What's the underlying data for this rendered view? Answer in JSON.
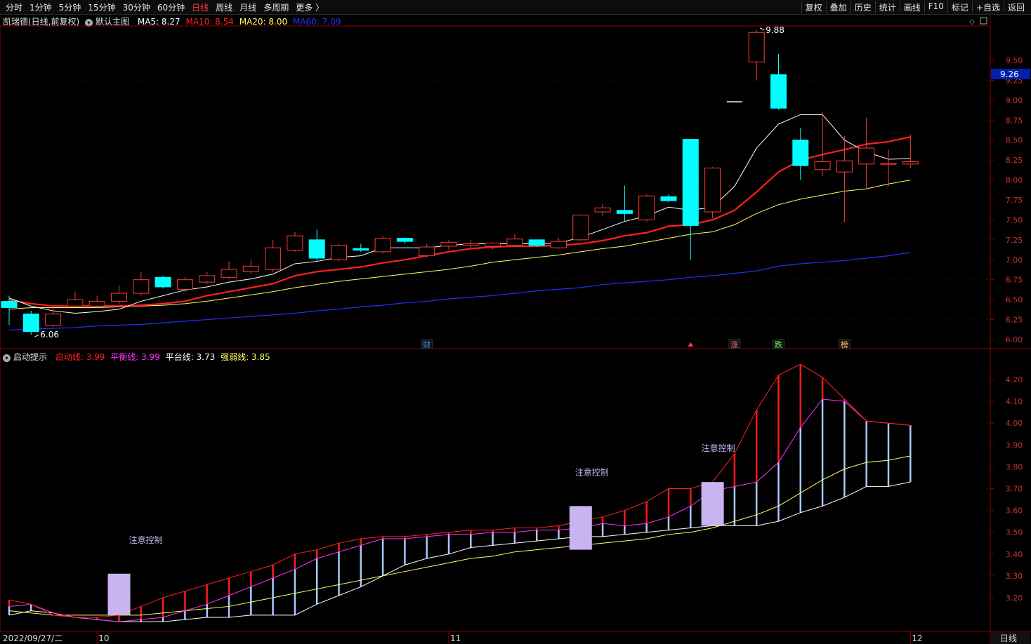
{
  "toolbar": {
    "periods": [
      "分时",
      "1分钟",
      "5分钟",
      "15分钟",
      "30分钟",
      "60分钟",
      "日线",
      "周线",
      "月线",
      "多周期",
      "更多 〉"
    ],
    "active_period": "日线",
    "actions": [
      "复权",
      "叠加",
      "历史",
      "统计",
      "画线",
      "F10",
      "标记",
      "+自选",
      "返回"
    ]
  },
  "main_header": {
    "stock": "凯瑞德(日线,前复权)",
    "template": "默认主图",
    "ma5_label": "MA5: 8.27",
    "ma10_label": "MA10: 8.54",
    "ma20_label": "MA20: 8.00",
    "ma60_label": "MA60: 7.09"
  },
  "sub_header": {
    "name": "启动提示",
    "qidong_label": "启动线: 3.99",
    "pingheng_label": "平衡线: 3.99",
    "pingtai_label": "平台线: 3.73",
    "qiangruo_label": "强弱线: 3.85"
  },
  "annotations": {
    "high": "9.88",
    "low": "6.06",
    "current_price": "9.26",
    "attention": "注意控制",
    "events": [
      "财",
      "涨",
      "跌",
      "榜"
    ]
  },
  "x_axis": {
    "start": "2022/09/27/二",
    "oct": "10",
    "nov": "11",
    "dec": "12",
    "period_label": "日线"
  },
  "colors": {
    "up": "#ff3b3b",
    "down": "#00ffff",
    "ma5": "#ffffff",
    "ma10": "#ff2020",
    "ma20": "#ffff66",
    "ma60": "#2233ff",
    "qidong": "#ff2020",
    "pingheng": "#ff33ff",
    "pingtai": "#ffffff",
    "qiangruo": "#ffff66",
    "attention": "#c8b4f0"
  },
  "chart_data": [
    {
      "type": "candlestick",
      "title": "凯瑞德(日线,前复权)",
      "ylim": [
        6.0,
        9.9
      ],
      "yticks": [
        6.0,
        6.25,
        6.5,
        6.75,
        7.0,
        7.25,
        7.5,
        7.75,
        8.0,
        8.25,
        8.5,
        8.75,
        9.0,
        9.25,
        9.5
      ],
      "candles": [
        {
          "o": 6.48,
          "h": 6.55,
          "l": 6.18,
          "c": 6.4
        },
        {
          "o": 6.32,
          "h": 6.36,
          "l": 6.06,
          "c": 6.1
        },
        {
          "o": 6.18,
          "h": 6.4,
          "l": 6.16,
          "c": 6.32
        },
        {
          "o": 6.42,
          "h": 6.6,
          "l": 6.4,
          "c": 6.5
        },
        {
          "o": 6.42,
          "h": 6.55,
          "l": 6.4,
          "c": 6.48
        },
        {
          "o": 6.48,
          "h": 6.68,
          "l": 6.45,
          "c": 6.58
        },
        {
          "o": 6.58,
          "h": 6.85,
          "l": 6.55,
          "c": 6.75
        },
        {
          "o": 6.78,
          "h": 6.8,
          "l": 6.64,
          "c": 6.66
        },
        {
          "o": 6.63,
          "h": 6.78,
          "l": 6.6,
          "c": 6.75
        },
        {
          "o": 6.72,
          "h": 6.85,
          "l": 6.7,
          "c": 6.8
        },
        {
          "o": 6.78,
          "h": 6.98,
          "l": 6.76,
          "c": 6.88
        },
        {
          "o": 6.85,
          "h": 7.0,
          "l": 6.82,
          "c": 6.92
        },
        {
          "o": 6.88,
          "h": 7.25,
          "l": 6.85,
          "c": 7.15
        },
        {
          "o": 7.12,
          "h": 7.35,
          "l": 7.1,
          "c": 7.3
        },
        {
          "o": 7.25,
          "h": 7.38,
          "l": 6.98,
          "c": 7.02
        },
        {
          "o": 7.0,
          "h": 7.2,
          "l": 6.98,
          "c": 7.18
        },
        {
          "o": 7.14,
          "h": 7.2,
          "l": 7.1,
          "c": 7.12
        },
        {
          "o": 7.1,
          "h": 7.3,
          "l": 7.08,
          "c": 7.27
        },
        {
          "o": 7.27,
          "h": 7.28,
          "l": 7.2,
          "c": 7.23
        },
        {
          "o": 7.05,
          "h": 7.2,
          "l": 7.03,
          "c": 7.16
        },
        {
          "o": 7.17,
          "h": 7.25,
          "l": 7.13,
          "c": 7.22
        },
        {
          "o": 7.18,
          "h": 7.25,
          "l": 7.15,
          "c": 7.2
        },
        {
          "o": 7.17,
          "h": 7.22,
          "l": 7.13,
          "c": 7.21
        },
        {
          "o": 7.18,
          "h": 7.32,
          "l": 7.16,
          "c": 7.26
        },
        {
          "o": 7.25,
          "h": 7.25,
          "l": 7.16,
          "c": 7.18
        },
        {
          "o": 7.15,
          "h": 7.27,
          "l": 7.14,
          "c": 7.23
        },
        {
          "o": 7.25,
          "h": 7.57,
          "l": 7.24,
          "c": 7.56
        },
        {
          "o": 7.6,
          "h": 7.7,
          "l": 7.55,
          "c": 7.65
        },
        {
          "o": 7.62,
          "h": 7.93,
          "l": 7.48,
          "c": 7.58
        },
        {
          "o": 7.5,
          "h": 7.82,
          "l": 7.48,
          "c": 7.8
        },
        {
          "o": 7.79,
          "h": 7.82,
          "l": 7.72,
          "c": 7.74
        },
        {
          "o": 8.51,
          "h": 8.51,
          "l": 7.0,
          "c": 7.43
        },
        {
          "o": 7.6,
          "h": 8.16,
          "l": 7.52,
          "c": 8.15
        },
        {
          "o": 8.98,
          "h": 8.99,
          "l": 8.97,
          "c": 8.98
        },
        {
          "o": 9.48,
          "h": 9.88,
          "l": 9.25,
          "c": 9.85
        },
        {
          "o": 9.32,
          "h": 9.58,
          "l": 8.88,
          "c": 8.9
        },
        {
          "o": 8.5,
          "h": 8.65,
          "l": 8.0,
          "c": 8.18
        },
        {
          "o": 8.13,
          "h": 8.85,
          "l": 8.05,
          "c": 8.23
        },
        {
          "o": 8.1,
          "h": 8.55,
          "l": 7.47,
          "c": 8.24
        },
        {
          "o": 8.2,
          "h": 8.78,
          "l": 7.9,
          "c": 8.4
        },
        {
          "o": 8.2,
          "h": 8.38,
          "l": 7.92,
          "c": 8.21
        },
        {
          "o": 8.2,
          "h": 8.57,
          "l": 8.15,
          "c": 8.23
        }
      ],
      "ma5": [
        6.52,
        6.42,
        6.36,
        6.33,
        6.35,
        6.38,
        6.48,
        6.55,
        6.62,
        6.66,
        6.72,
        6.76,
        6.82,
        6.95,
        6.98,
        7.03,
        7.05,
        7.15,
        7.15,
        7.15,
        7.18,
        7.2,
        7.2,
        7.2,
        7.2,
        7.21,
        7.28,
        7.38,
        7.48,
        7.55,
        7.66,
        7.62,
        7.66,
        7.92,
        8.4,
        8.7,
        8.82,
        8.82,
        8.5,
        8.35,
        8.26,
        8.27
      ],
      "ma10": [
        6.5,
        6.45,
        6.42,
        6.42,
        6.42,
        6.42,
        6.43,
        6.45,
        6.48,
        6.55,
        6.6,
        6.65,
        6.7,
        6.8,
        6.85,
        6.88,
        6.91,
        6.96,
        7.0,
        7.05,
        7.1,
        7.14,
        7.16,
        7.17,
        7.17,
        7.18,
        7.2,
        7.24,
        7.3,
        7.34,
        7.42,
        7.44,
        7.5,
        7.62,
        7.85,
        8.1,
        8.25,
        8.32,
        8.38,
        8.45,
        8.48,
        8.54
      ],
      "ma20": [
        6.38,
        6.4,
        6.4,
        6.4,
        6.4,
        6.41,
        6.42,
        6.43,
        6.45,
        6.48,
        6.52,
        6.56,
        6.6,
        6.65,
        6.69,
        6.73,
        6.76,
        6.79,
        6.82,
        6.85,
        6.88,
        6.92,
        6.97,
        7.0,
        7.03,
        7.06,
        7.1,
        7.14,
        7.17,
        7.22,
        7.27,
        7.32,
        7.35,
        7.44,
        7.58,
        7.69,
        7.76,
        7.81,
        7.86,
        7.89,
        7.95,
        8.0
      ],
      "ma60": [
        6.12,
        6.13,
        6.14,
        6.15,
        6.17,
        6.18,
        6.19,
        6.21,
        6.23,
        6.25,
        6.27,
        6.29,
        6.31,
        6.33,
        6.36,
        6.38,
        6.41,
        6.43,
        6.46,
        6.48,
        6.51,
        6.53,
        6.55,
        6.58,
        6.61,
        6.63,
        6.65,
        6.69,
        6.71,
        6.73,
        6.75,
        6.78,
        6.8,
        6.83,
        6.86,
        6.92,
        6.95,
        6.97,
        6.99,
        7.02,
        7.05,
        7.09
      ]
    },
    {
      "type": "line",
      "title": "启动提示",
      "ylim": [
        3.1,
        4.3
      ],
      "yticks": [
        3.2,
        3.3,
        3.4,
        3.5,
        3.6,
        3.7,
        3.8,
        3.9,
        4.0,
        4.1,
        4.2
      ],
      "series": [
        {
          "name": "启动线",
          "values": [
            3.19,
            3.17,
            3.12,
            3.11,
            3.11,
            3.12,
            3.16,
            3.2,
            3.23,
            3.26,
            3.29,
            3.32,
            3.35,
            3.4,
            3.42,
            3.45,
            3.47,
            3.48,
            3.48,
            3.49,
            3.5,
            3.51,
            3.51,
            3.52,
            3.52,
            3.53,
            3.55,
            3.57,
            3.6,
            3.64,
            3.7,
            3.7,
            3.73,
            3.86,
            4.06,
            4.22,
            4.27,
            4.21,
            4.11,
            4.01,
            4.0,
            3.99
          ]
        },
        {
          "name": "平衡线",
          "values": [
            3.16,
            3.17,
            3.13,
            3.11,
            3.1,
            3.09,
            3.1,
            3.11,
            3.14,
            3.17,
            3.21,
            3.25,
            3.29,
            3.33,
            3.38,
            3.41,
            3.44,
            3.47,
            3.47,
            3.48,
            3.49,
            3.49,
            3.5,
            3.5,
            3.51,
            3.51,
            3.52,
            3.54,
            3.53,
            3.54,
            3.57,
            3.62,
            3.69,
            3.71,
            3.73,
            3.82,
            3.98,
            4.11,
            4.1,
            4.01,
            4.0,
            3.99
          ]
        },
        {
          "name": "平台线",
          "values": [
            3.12,
            3.14,
            3.13,
            3.11,
            3.1,
            3.09,
            3.09,
            3.09,
            3.1,
            3.11,
            3.11,
            3.12,
            3.12,
            3.12,
            3.17,
            3.21,
            3.25,
            3.3,
            3.35,
            3.38,
            3.4,
            3.43,
            3.44,
            3.45,
            3.46,
            3.47,
            3.48,
            3.48,
            3.49,
            3.5,
            3.51,
            3.52,
            3.53,
            3.53,
            3.53,
            3.55,
            3.59,
            3.62,
            3.66,
            3.71,
            3.71,
            3.73
          ]
        },
        {
          "name": "强弱线",
          "values": [
            3.14,
            3.13,
            3.12,
            3.12,
            3.12,
            3.12,
            3.12,
            3.13,
            3.14,
            3.15,
            3.16,
            3.18,
            3.2,
            3.22,
            3.24,
            3.26,
            3.28,
            3.3,
            3.32,
            3.34,
            3.36,
            3.38,
            3.39,
            3.41,
            3.42,
            3.43,
            3.44,
            3.45,
            3.46,
            3.47,
            3.49,
            3.5,
            3.52,
            3.55,
            3.58,
            3.62,
            3.68,
            3.74,
            3.79,
            3.82,
            3.83,
            3.85
          ]
        }
      ],
      "attention_boxes": [
        {
          "index": 5,
          "top": 3.31,
          "bottom": 3.12
        },
        {
          "index": 26,
          "top": 3.62,
          "bottom": 3.42
        },
        {
          "index": 32,
          "top": 3.73,
          "bottom": 3.53
        }
      ]
    }
  ]
}
